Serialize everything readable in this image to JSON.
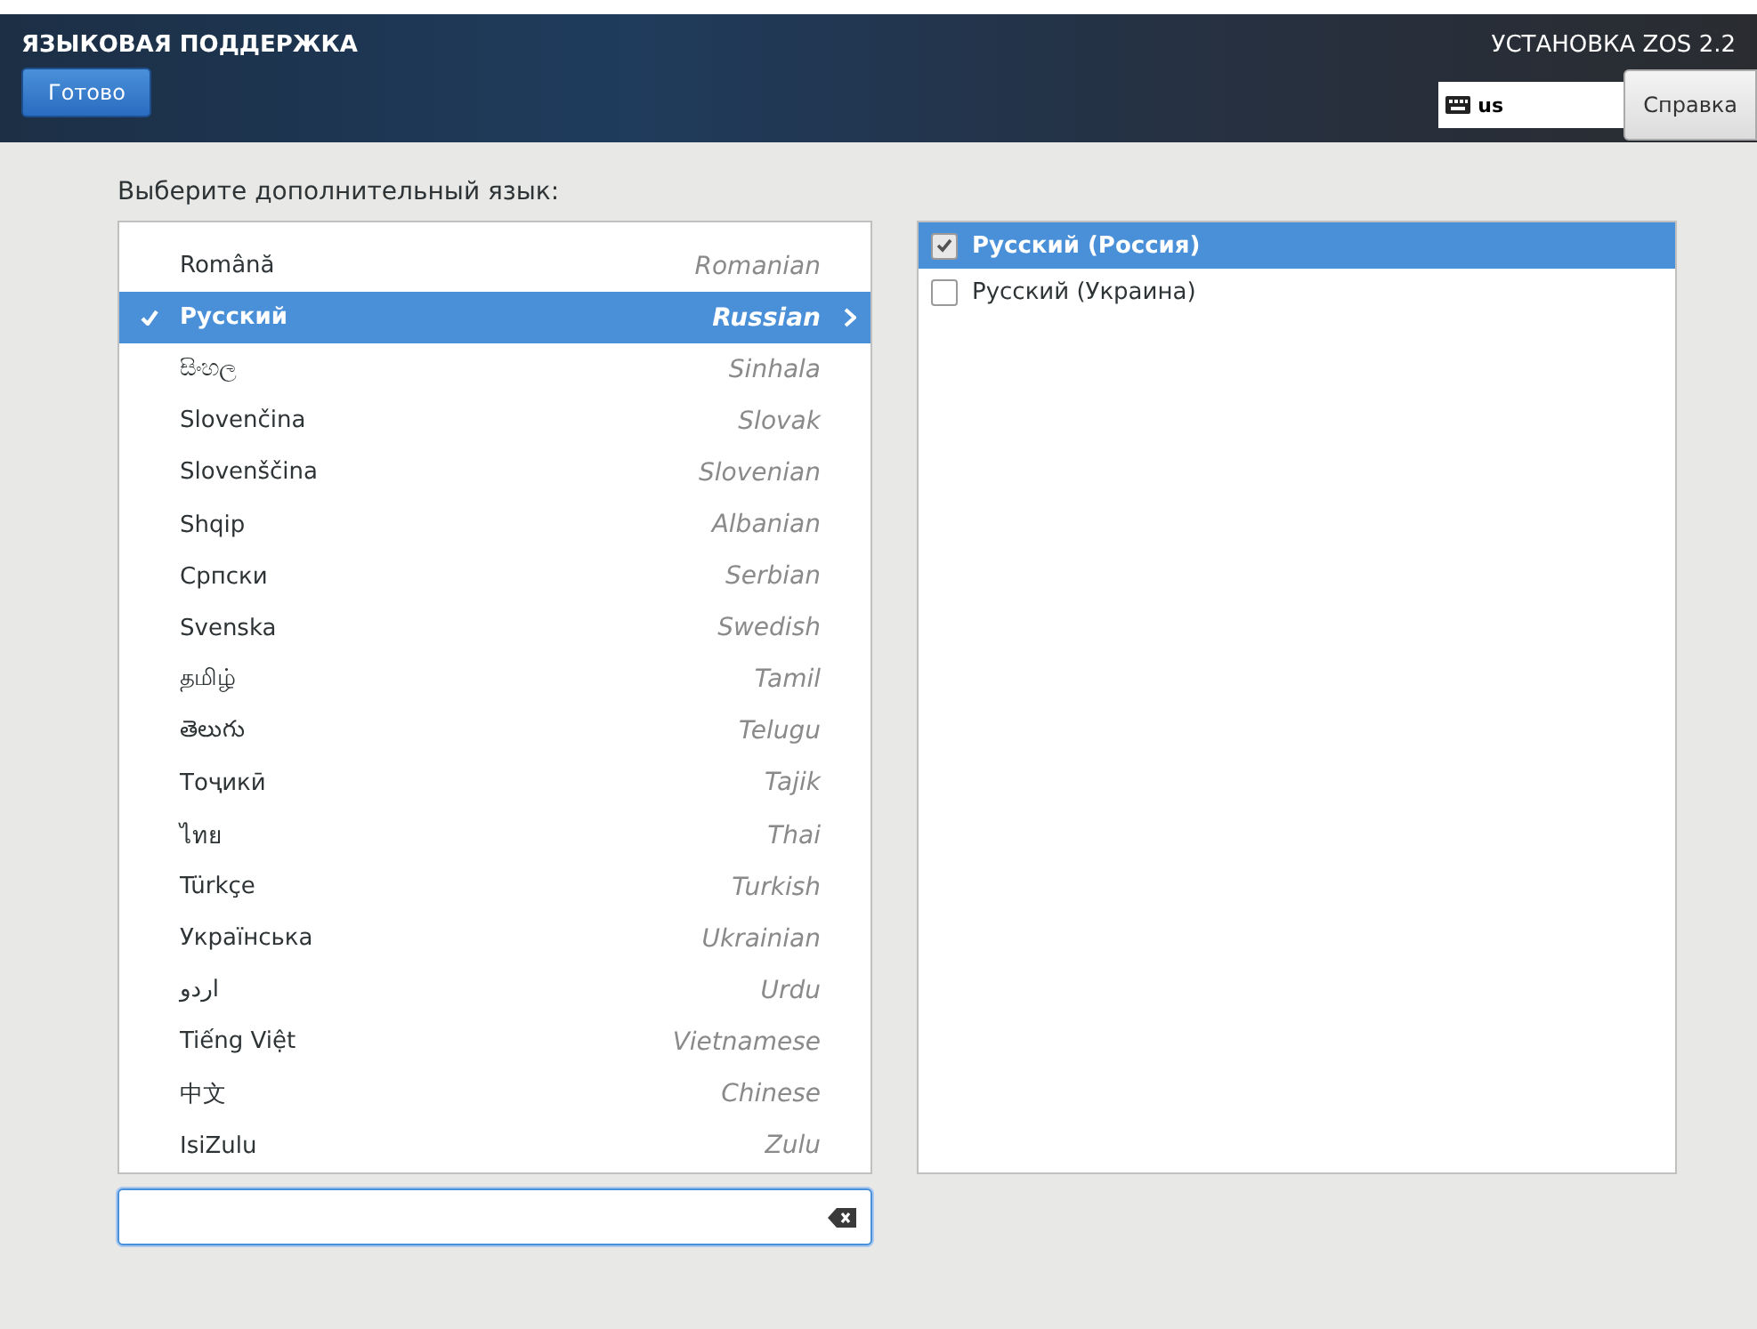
{
  "header": {
    "title": "ЯЗЫКОВАЯ ПОДДЕРЖКА",
    "done_button": "Готово",
    "product": "УСТАНОВКА ZOS 2.2",
    "keyboard_layout": "us",
    "help_button": "Справка"
  },
  "prompt": "Выберите дополнительный язык:",
  "languages": [
    {
      "native": "Română",
      "english": "Romanian",
      "selected": false
    },
    {
      "native": "Русский",
      "english": "Russian",
      "selected": true
    },
    {
      "native": "සිංහල",
      "english": "Sinhala",
      "selected": false
    },
    {
      "native": "Slovenčina",
      "english": "Slovak",
      "selected": false
    },
    {
      "native": "Slovenščina",
      "english": "Slovenian",
      "selected": false
    },
    {
      "native": "Shqip",
      "english": "Albanian",
      "selected": false
    },
    {
      "native": "Српски",
      "english": "Serbian",
      "selected": false
    },
    {
      "native": "Svenska",
      "english": "Swedish",
      "selected": false
    },
    {
      "native": "தமிழ்",
      "english": "Tamil",
      "selected": false
    },
    {
      "native": "తెలుగు",
      "english": "Telugu",
      "selected": false
    },
    {
      "native": "Тоҷикӣ",
      "english": "Tajik",
      "selected": false
    },
    {
      "native": "ไทย",
      "english": "Thai",
      "selected": false
    },
    {
      "native": "Türkçe",
      "english": "Turkish",
      "selected": false
    },
    {
      "native": "Українська",
      "english": "Ukrainian",
      "selected": false
    },
    {
      "native": "اردو",
      "english": "Urdu",
      "selected": false
    },
    {
      "native": "Tiếng Việt",
      "english": "Vietnamese",
      "selected": false
    },
    {
      "native": "中文",
      "english": "Chinese",
      "selected": false
    },
    {
      "native": "IsiZulu",
      "english": "Zulu",
      "selected": false
    }
  ],
  "locales": [
    {
      "label": "Русский (Россия)",
      "checked": true,
      "selected": true
    },
    {
      "label": "Русский (Украина)",
      "checked": false,
      "selected": false
    }
  ]
}
